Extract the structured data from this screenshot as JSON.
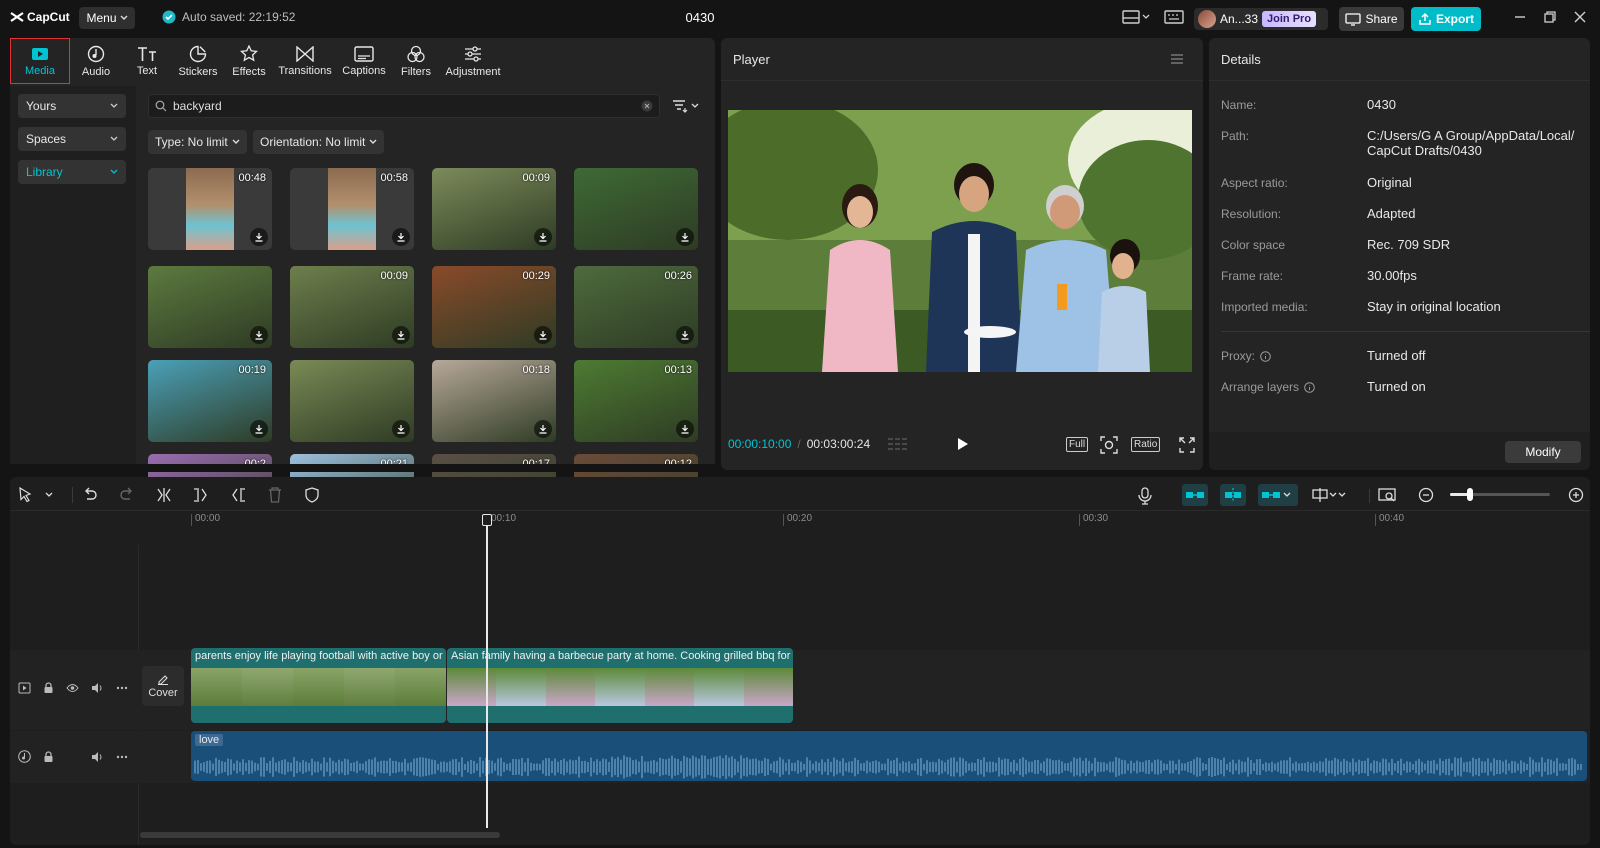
{
  "topbar": {
    "logo": "CapCut",
    "menu": "Menu",
    "autosave": "Auto saved: 22:19:52",
    "title": "0430",
    "account_name": "An...33",
    "join_pro": "Join Pro",
    "share": "Share",
    "export": "Export"
  },
  "toolbar": [
    {
      "label": "Media",
      "icon": "media-icon"
    },
    {
      "label": "Audio",
      "icon": "audio-icon"
    },
    {
      "label": "Text",
      "icon": "text-icon"
    },
    {
      "label": "Stickers",
      "icon": "stickers-icon"
    },
    {
      "label": "Effects",
      "icon": "effects-icon"
    },
    {
      "label": "Transitions",
      "icon": "transitions-icon"
    },
    {
      "label": "Captions",
      "icon": "captions-icon"
    },
    {
      "label": "Filters",
      "icon": "filters-icon"
    },
    {
      "label": "Adjustment",
      "icon": "adjustment-icon"
    }
  ],
  "sidebar": [
    {
      "label": "Yours"
    },
    {
      "label": "Spaces"
    },
    {
      "label": "Library"
    }
  ],
  "search": {
    "value": "backyard"
  },
  "filters": {
    "type": "Type: No limit",
    "orientation": "Orientation: No limit"
  },
  "media": [
    {
      "duration": "00:48",
      "color": "#6a8a6a"
    },
    {
      "duration": "00:58",
      "color": "#6a8a6a"
    },
    {
      "duration": "00:09",
      "color": "#7c8b5a"
    },
    {
      "duration": "",
      "color": "#3e6a35"
    },
    {
      "duration": "",
      "color": "#5d7a3f"
    },
    {
      "duration": "00:09",
      "color": "#6e7f4c"
    },
    {
      "duration": "00:29",
      "color": "#8a4a2a"
    },
    {
      "duration": "00:26",
      "color": "#4e6b3d"
    },
    {
      "duration": "00:19",
      "color": "#4aa0b8"
    },
    {
      "duration": "",
      "color": "#7a8a55"
    },
    {
      "duration": "00:18",
      "color": "#b7a89a"
    },
    {
      "duration": "00:13",
      "color": "#4d7b32"
    },
    {
      "duration": "00:2",
      "color": "#9a6cb0"
    },
    {
      "duration": "00:21",
      "color": "#9cc0dd"
    },
    {
      "duration": "00:17",
      "color": "#5a4f46"
    },
    {
      "duration": "00:12",
      "color": "#6b4b3a"
    }
  ],
  "player": {
    "title": "Player",
    "current_time": "00:00:10:00",
    "total_time": "00:03:00:24",
    "full_label": "Full",
    "ratio_label": "Ratio"
  },
  "details": {
    "title": "Details",
    "rows": [
      {
        "label": "Name:",
        "value": "0430"
      },
      {
        "label": "Path:",
        "value": "C:/Users/G A Group/AppData/Local/ CapCut Drafts/0430"
      },
      {
        "label": "Aspect ratio:",
        "value": "Original"
      },
      {
        "label": "Resolution:",
        "value": "Adapted"
      },
      {
        "label": "Color space",
        "value": "Rec. 709 SDR"
      },
      {
        "label": "Frame rate:",
        "value": "30.00fps"
      },
      {
        "label": "Imported media:",
        "value": "Stay in original location"
      },
      {
        "label": "Proxy:",
        "value": "Turned off"
      },
      {
        "label": "Arrange layers",
        "value": "Turned on"
      }
    ],
    "modify": "Modify"
  },
  "timeline": {
    "ruler": [
      "00:00",
      "00:10",
      "00:20",
      "00:30",
      "00:40"
    ],
    "cover": "Cover",
    "clip1": "parents enjoy life playing football with active boy or",
    "clip2": "Asian family having a barbecue party at home. Cooking grilled bbq for c",
    "audio": "love",
    "zoom_level": 0.2
  },
  "colors": {
    "accent": "#00c4d1",
    "export": "#00bcc8",
    "video_track": "#1f6f6f",
    "audio_track": "#1a4f7a"
  }
}
